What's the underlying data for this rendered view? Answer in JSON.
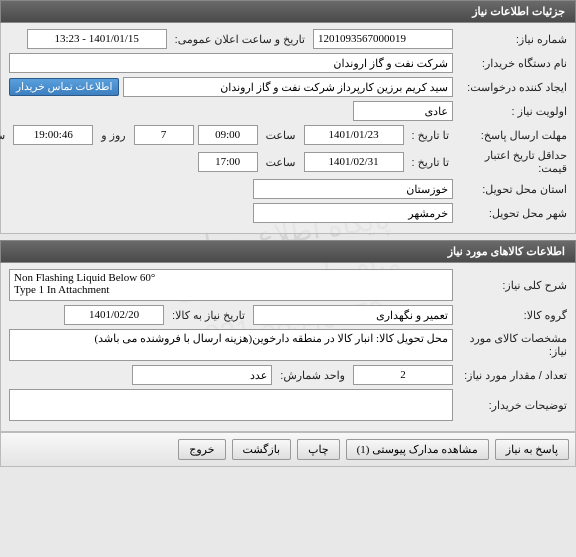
{
  "watermark": {
    "line1": "پایگاه اطلاع رسانی مناقصات و مزایدات",
    "line2": "021-88349670"
  },
  "panel1": {
    "title": "جزئیات اطلاعات نیاز",
    "need_no_label": "شماره نیاز:",
    "need_no": "1201093567000019",
    "announce_label": "تاریخ و ساعت اعلان عمومی:",
    "announce": "1401/01/15 - 13:23",
    "buyer_label": "نام دستگاه خریدار:",
    "buyer": "شرکت نفت و گاز اروندان",
    "creator_label": "ایجاد کننده درخواست:",
    "creator": "سید کریم برزین کارپرداز شرکت نفت و گاز اروندان",
    "contact_btn": "اطلاعات تماس خریدار",
    "priority_label": "اولویت نیاز :",
    "priority": "عادی",
    "deadline_label": "مهلت ارسال پاسخ:",
    "until_label": "تا تاریخ :",
    "deadline_date": "1401/01/23",
    "time_label": "ساعت",
    "deadline_time": "09:00",
    "days": "7",
    "days_label": "روز و",
    "countdown": "19:00:46",
    "remain_label": "ساعت باقی مانده",
    "validity_label": "حداقل تاریخ اعتبار قیمت:",
    "validity_date": "1401/02/31",
    "validity_time": "17:00",
    "province_label": "استان محل تحویل:",
    "province": "خوزستان",
    "city_label": "شهر محل تحویل:",
    "city": "خرمشهر"
  },
  "panel2": {
    "title": "اطلاعات کالاهای مورد نیاز",
    "desc_label": "شرح کلی نیاز:",
    "desc": "Non Flashing Liquid Below 60°\nType 1 In Attachment",
    "group_label": "گروه کالا:",
    "group": "تعمیر و نگهداری",
    "need_date_label": "تاریخ نیاز به کالا:",
    "need_date": "1401/02/20",
    "spec_label": "مشخصات کالای مورد نیاز:",
    "spec": "محل تحویل کالا: انبار کالا در منطقه دارخوین(هزینه ارسال با فروشنده می باشد)",
    "qty_label": "تعداد / مقدار مورد نیاز:",
    "qty": "2",
    "unit_label": "واحد شمارش:",
    "unit": "عدد",
    "notes_label": "توضیحات خریدار:"
  },
  "footer": {
    "respond": "پاسخ به نیاز",
    "attachments": "مشاهده مدارک پیوستی (1)",
    "print": "چاپ",
    "back": "بازگشت",
    "exit": "خروج"
  }
}
